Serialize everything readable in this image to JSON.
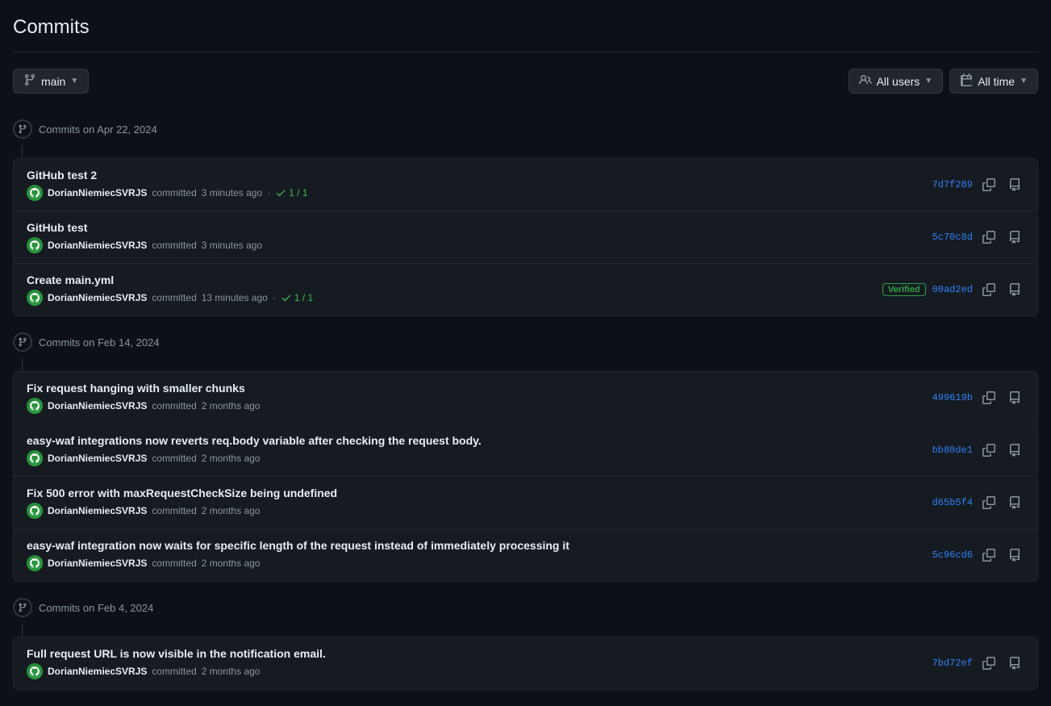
{
  "page": {
    "title": "Commits"
  },
  "toolbar": {
    "branch_label": "main",
    "branch_icon": "⎇",
    "users_label": "All users",
    "time_label": "All time",
    "users_icon": "👤",
    "calendar_icon": "📅"
  },
  "date_groups": [
    {
      "date": "Commits on Apr 22, 2024",
      "commits": [
        {
          "id": "commit-1",
          "message": "GitHub test 2",
          "author": "DorianNiemiecSVRJS",
          "time": "3 minutes ago",
          "check": "1 / 1",
          "verified": false,
          "hash": "7d7f289"
        },
        {
          "id": "commit-2",
          "message": "GitHub test",
          "author": "DorianNiemiecSVRJS",
          "time": "3 minutes ago",
          "check": null,
          "verified": false,
          "hash": "5c70c8d"
        },
        {
          "id": "commit-3",
          "message": "Create main.yml",
          "author": "DorianNiemiecSVRJS",
          "time": "13 minutes ago",
          "check": "1 / 1",
          "verified": true,
          "hash": "00ad2ed"
        }
      ]
    },
    {
      "date": "Commits on Feb 14, 2024",
      "commits": [
        {
          "id": "commit-4",
          "message": "Fix request hanging with smaller chunks",
          "author": "DorianNiemiecSVRJS",
          "time": "2 months ago",
          "check": null,
          "verified": false,
          "hash": "499619b"
        },
        {
          "id": "commit-5",
          "message": "easy-waf integrations now reverts req.body variable after checking the request body.",
          "author": "DorianNiemiecSVRJS",
          "time": "2 months ago",
          "check": null,
          "verified": false,
          "hash": "bb80de1"
        },
        {
          "id": "commit-6",
          "message": "Fix 500 error with maxRequestCheckSize being undefined",
          "author": "DorianNiemiecSVRJS",
          "time": "2 months ago",
          "check": null,
          "verified": false,
          "hash": "d65b5f4"
        },
        {
          "id": "commit-7",
          "message": "easy-waf integration now waits for specific length of the request instead of immediately processing it",
          "author": "DorianNiemiecSVRJS",
          "time": "2 months ago",
          "check": null,
          "verified": false,
          "hash": "5c96cd6"
        }
      ]
    },
    {
      "date": "Commits on Feb 4, 2024",
      "commits": [
        {
          "id": "commit-8",
          "message": "Full request URL is now visible in the notification email.",
          "author": "DorianNiemiecSVRJS",
          "time": "2 months ago",
          "check": null,
          "verified": false,
          "hash": "7bd72ef"
        }
      ]
    }
  ],
  "labels": {
    "committed": "committed",
    "verified_label": "Verified",
    "copy_tooltip": "Copy full SHA",
    "browse_tooltip": "Browse the repository at this point in history"
  }
}
